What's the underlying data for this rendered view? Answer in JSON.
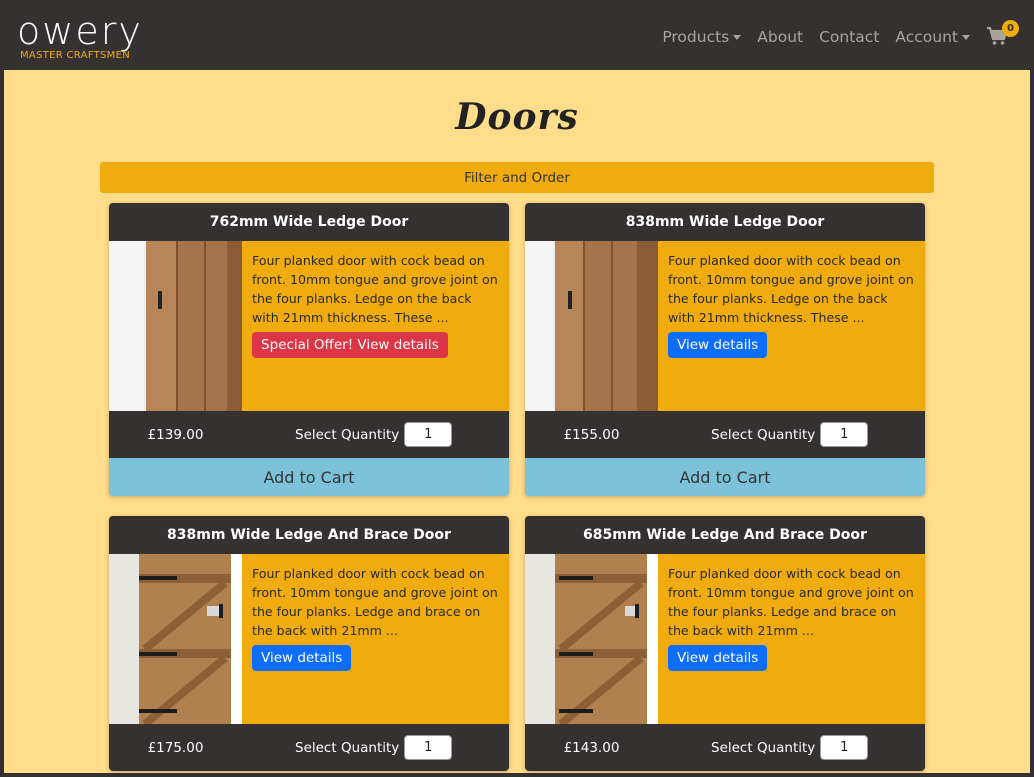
{
  "brand": {
    "name": "owery",
    "tagline": "MASTER CRAFTSMEN"
  },
  "nav": {
    "products": "Products",
    "about": "About",
    "contact": "Contact",
    "account": "Account",
    "cart_count": "0"
  },
  "page": {
    "title": "Doors",
    "filter_label": "Filter and Order"
  },
  "colors": {
    "navbar": "#353131",
    "accent": "#f0ac0f",
    "background": "#ffdd8a",
    "cart_button": "#7cc3d9",
    "offer": "#dc3545",
    "details": "#0d6efd"
  },
  "products": [
    {
      "title": "762mm Wide Ledge Door",
      "description": "Four planked door with cock bead on front. 10mm tongue and grove joint on the four planks. Ledge on the back with 21mm thickness. These ...",
      "button": "Special Offer! View details",
      "price": "£139.00",
      "qty_label": "Select Quantity",
      "qty": "1",
      "add_to_cart": "Add to Cart"
    },
    {
      "title": "838mm Wide Ledge Door",
      "description": "Four planked door with cock bead on front. 10mm tongue and grove joint on the four planks. Ledge on the back with 21mm thickness. These ...",
      "button": "View details",
      "price": "£155.00",
      "qty_label": "Select Quantity",
      "qty": "1",
      "add_to_cart": "Add to Cart"
    },
    {
      "title": "838mm Wide Ledge And Brace Door",
      "description": "Four planked door with cock bead on front. 10mm tongue and grove joint on the four planks. Ledge and brace on the back with 21mm ...",
      "button": "View details",
      "price": "£175.00",
      "qty_label": "Select Quantity",
      "qty": "1"
    },
    {
      "title": "685mm Wide Ledge And Brace Door",
      "description": "Four planked door with cock bead on front. 10mm tongue and grove joint on the four planks. Ledge and brace on the back with 21mm ...",
      "button": "View details",
      "price": "£143.00",
      "qty_label": "Select Quantity",
      "qty": "1"
    }
  ]
}
